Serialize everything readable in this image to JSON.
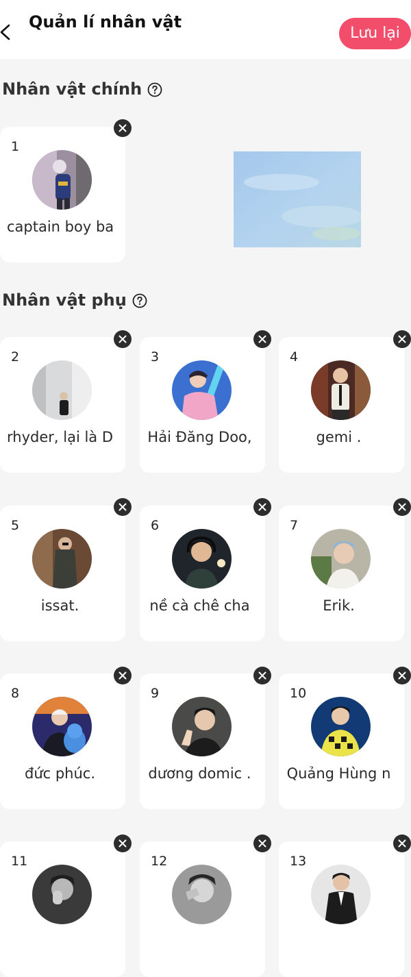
{
  "header": {
    "title": "Quản lí nhân vật",
    "save_label": "Lưu lại"
  },
  "main_section": {
    "title": "Nhân vật chính",
    "characters": [
      {
        "number": "1",
        "name": "captain boy bae"
      }
    ]
  },
  "side_section": {
    "title": "Nhân vật phụ",
    "characters": [
      {
        "number": "2",
        "name": "rhyder, lại là DC"
      },
      {
        "number": "3",
        "name": "Hải Đăng Doo,"
      },
      {
        "number": "4",
        "name": "gemi ."
      },
      {
        "number": "5",
        "name": "issat."
      },
      {
        "number": "6",
        "name": "nề cà chê cha"
      },
      {
        "number": "7",
        "name": "Erik."
      },
      {
        "number": "8",
        "name": "đức phúc."
      },
      {
        "number": "9",
        "name": "dương domic ."
      },
      {
        "number": "10",
        "name": "Quảng Hùng n"
      },
      {
        "number": "11",
        "name": ""
      },
      {
        "number": "12",
        "name": ""
      },
      {
        "number": "13",
        "name": ""
      }
    ]
  },
  "colors": {
    "accent": "#f34d6c",
    "background": "#f5f5f6",
    "card": "#ffffff"
  }
}
